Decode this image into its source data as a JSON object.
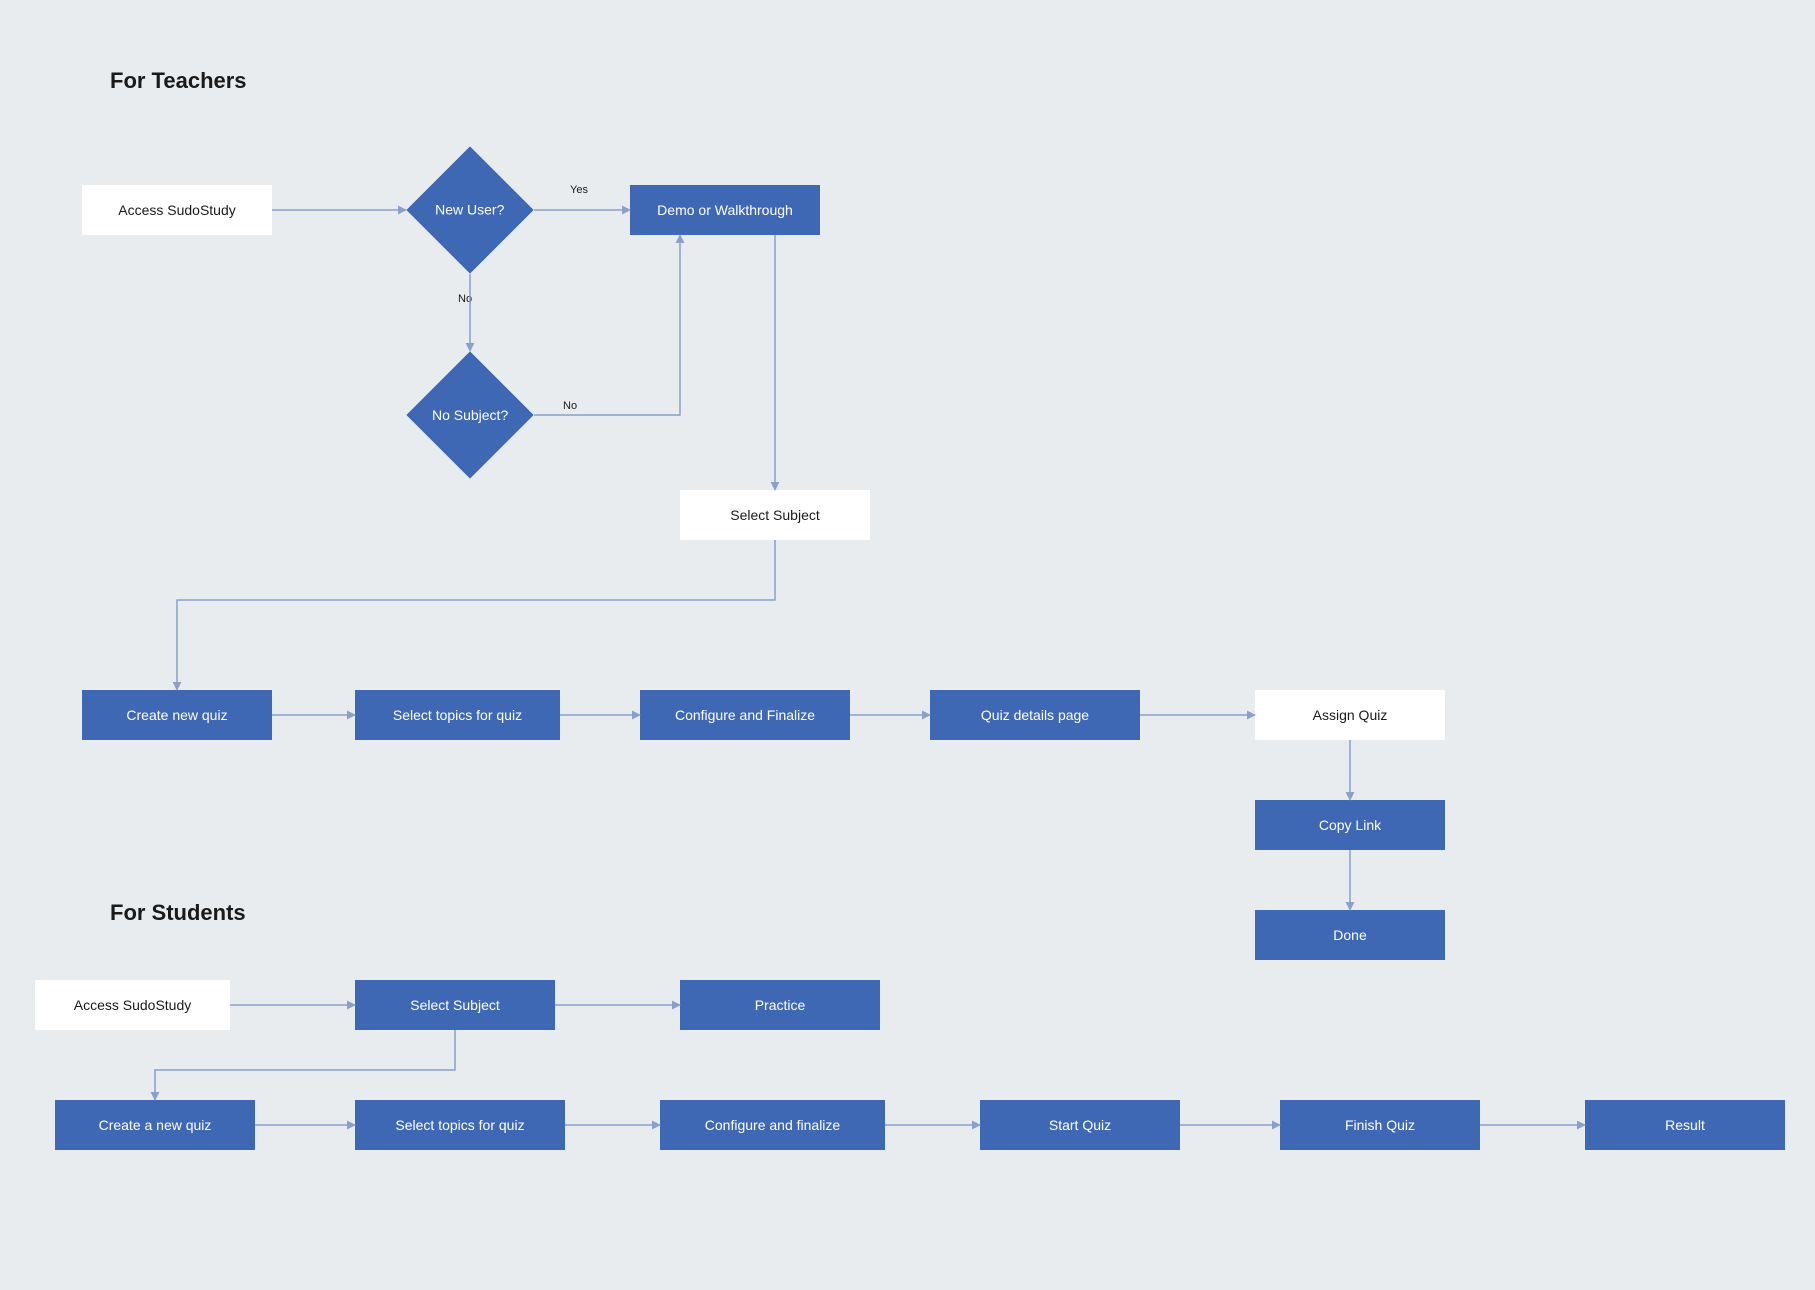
{
  "teachers": {
    "title": "For Teachers",
    "access": "Access SudoStudy",
    "newUser": "New User?",
    "noSubject": "No Subject?",
    "demo": "Demo or Walkthrough",
    "selectSubject": "Select Subject",
    "createQuiz": "Create new quiz",
    "selectTopics": "Select topics for quiz",
    "configure": "Configure and Finalize",
    "details": "Quiz details page",
    "assign": "Assign Quiz",
    "copyLink": "Copy Link",
    "done": "Done",
    "yes": "Yes",
    "noTop": "No",
    "noBottom": "No"
  },
  "students": {
    "title": "For Students",
    "access": "Access SudoStudy",
    "selectSubject": "Select Subject",
    "practice": "Practice",
    "createQuiz": "Create a new quiz",
    "selectTopics": "Select topics for quiz",
    "configure": "Configure and finalize",
    "start": "Start Quiz",
    "finish": "Finish Quiz",
    "result": "Result"
  },
  "colors": {
    "primary": "#3f68b4",
    "background": "#e9ecef",
    "arrow": "#8aa0c8"
  }
}
